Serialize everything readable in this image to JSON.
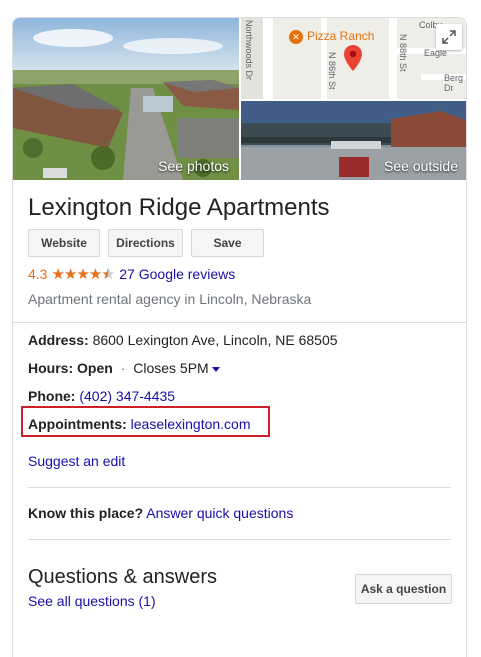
{
  "photos": {
    "see_photos": "See photos",
    "see_outside": "See outside",
    "map": {
      "place_label": "Pizza Ranch",
      "streets": [
        "Colby",
        "Northwoods Dr",
        "N 86th St",
        "N 88th St",
        "Eagle",
        "Berg Dr"
      ],
      "pin_color": "#ea4335",
      "place_color": "#e8710a"
    }
  },
  "business": {
    "name": "Lexington Ridge Apartments",
    "buttons": {
      "website": "Website",
      "directions": "Directions",
      "save": "Save"
    },
    "rating": {
      "score": "4.3",
      "stars_filled": 4.3,
      "reviews": "27 Google reviews"
    },
    "category": "Apartment rental agency in Lincoln, Nebraska"
  },
  "details": {
    "address": {
      "label": "Address:",
      "value": "8600 Lexington Ave, Lincoln, NE 68505"
    },
    "hours": {
      "label": "Hours:",
      "status": "Open",
      "separator": "·",
      "closes": "Closes 5PM"
    },
    "phone": {
      "label": "Phone:",
      "value": "(402) 347-4435"
    },
    "appointments": {
      "label": "Appointments:",
      "value": "leaselexington.com"
    },
    "suggest_edit": "Suggest an edit"
  },
  "know_place": {
    "label": "Know this place?",
    "link": "Answer quick questions"
  },
  "qa": {
    "title": "Questions & answers",
    "see_all": "See all questions (1)",
    "ask_button": "Ask a question"
  },
  "colors": {
    "link": "#1a0dab",
    "rating": "#e7711b",
    "highlight": "#cc1f27"
  }
}
